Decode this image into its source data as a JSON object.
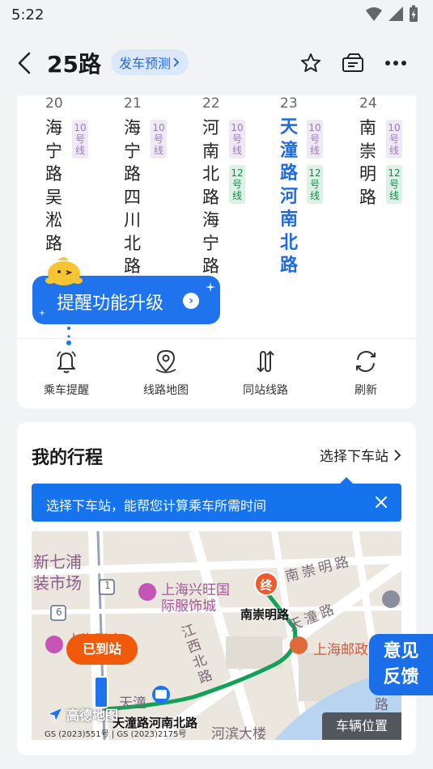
{
  "status": {
    "time": "5:22"
  },
  "header": {
    "route": "25路",
    "forecast_label": "发车预测"
  },
  "stops": [
    {
      "num": "20",
      "name": "海宁路吴淞路",
      "lines": [
        "10号线"
      ]
    },
    {
      "num": "21",
      "name": "海宁路四川北路",
      "lines": [
        "10号线"
      ]
    },
    {
      "num": "22",
      "name": "河南北路海宁路",
      "lines": [
        "10号线",
        "12号线"
      ]
    },
    {
      "num": "23",
      "name": "天潼路河南北路",
      "lines": [
        "10号线",
        "12号线"
      ],
      "current": true
    },
    {
      "num": "24",
      "name": "南崇明路",
      "lines": [
        "10号线",
        "12号线"
      ]
    }
  ],
  "upgrade": {
    "text": "提醒功能升级"
  },
  "actions": [
    {
      "label": "乘车提醒",
      "icon": "bell-icon"
    },
    {
      "label": "线路地图",
      "icon": "map-pin-icon"
    },
    {
      "label": "同站线路",
      "icon": "route-icon"
    },
    {
      "label": "刷新",
      "icon": "refresh-icon"
    }
  ],
  "trip": {
    "title": "我的行程",
    "choose_stop": "选择下车站",
    "tip": "选择下车站，能帮您计算乘车所需时间"
  },
  "map": {
    "labels": {
      "xinqipu": "新七浦",
      "shichang": "装市场",
      "xingwang": "上海兴旺国",
      "fushi": "际服饰城",
      "nanchongming_road": "南崇明路",
      "tiantong_road": "天潼路",
      "jiangxi_north": "江西北路",
      "post": "上海邮政",
      "hebin": "河滨大楼",
      "tiantong_short": "天潼",
      "lianhe": "上海联合",
      "lu": "路"
    },
    "arrived": "已到站",
    "end_marker": "终",
    "end_stop": "南崇明路",
    "start_stop": "天潼路河南北路",
    "vehicle_btn": "车辆位置",
    "logo": "高德地图",
    "gs": "GS (2023)551号 | GS (2023)2175号",
    "road_numbers": [
      "1",
      "6"
    ]
  },
  "feedback": {
    "line1": "意见",
    "line2": "反馈"
  },
  "colors": {
    "accent": "#1f6ae0",
    "route_green": "#13a15a",
    "orange": "#f05a0a"
  }
}
